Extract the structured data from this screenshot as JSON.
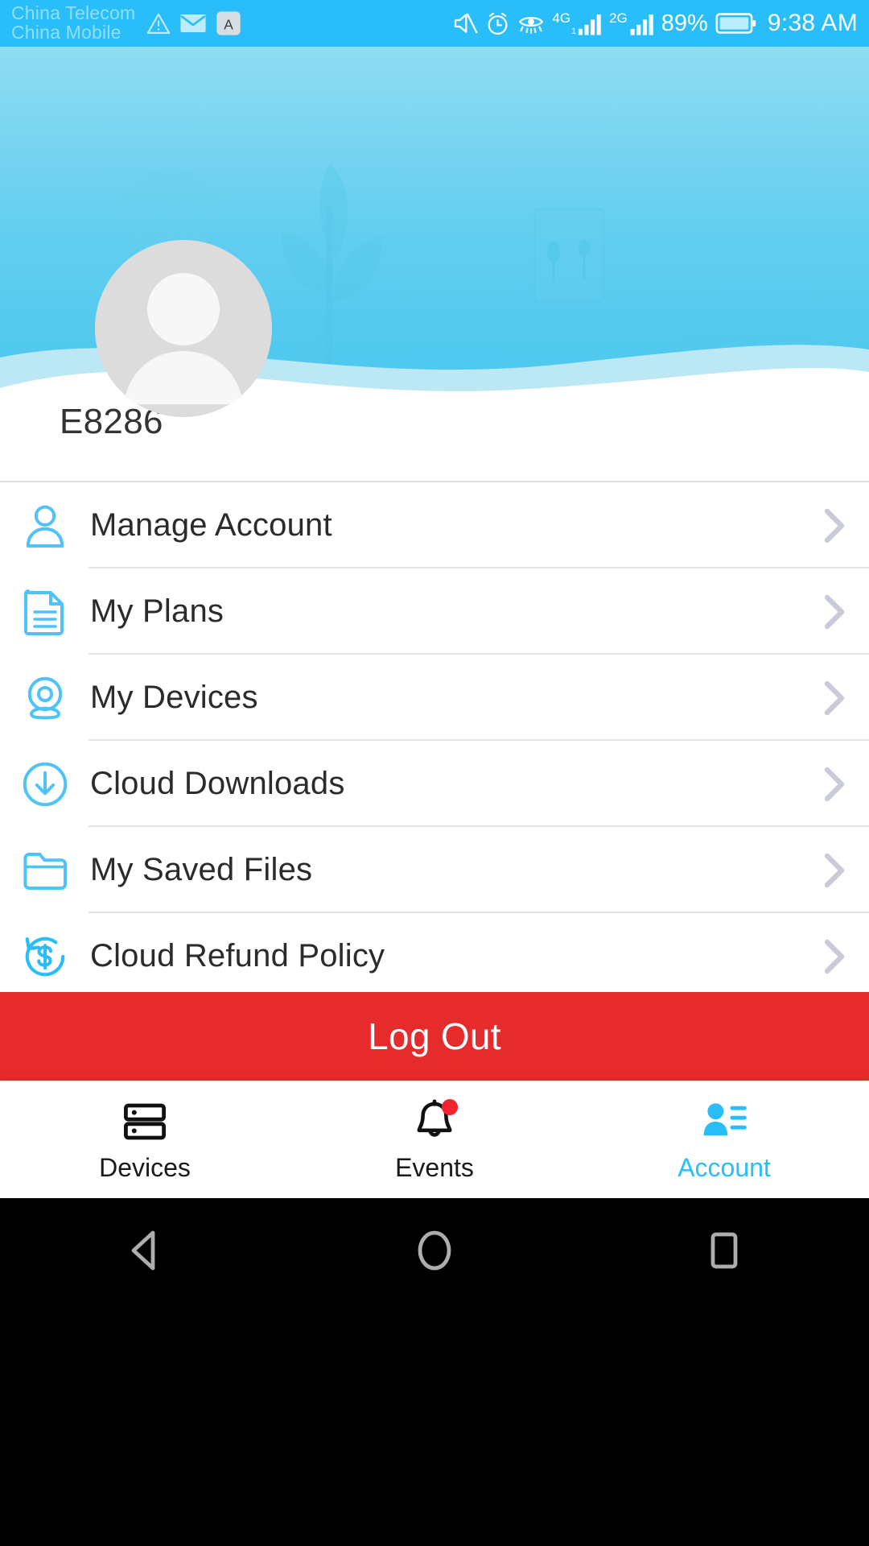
{
  "status_bar": {
    "carriers": [
      "China Telecom",
      "China Mobile"
    ],
    "left_icons": [
      "warning-triangle-icon",
      "mail-icon",
      "input-method-a-icon"
    ],
    "right_icons": [
      "mute-icon",
      "alarm-icon",
      "eye-comfort-icon",
      "signal-4g-icon",
      "signal-2g-icon",
      "battery-icon"
    ],
    "network_4g_label": "4G",
    "network_2g_label": "2G",
    "battery_percent": "89%",
    "time": "9:38 AM"
  },
  "profile": {
    "username": "E8286",
    "avatar_icon": "default-user-avatar"
  },
  "menu": {
    "items": [
      {
        "label": "Manage Account",
        "icon": "person-outline-icon",
        "chevron": "chevron-right-icon"
      },
      {
        "label": "My Plans",
        "icon": "document-icon",
        "chevron": "chevron-right-icon"
      },
      {
        "label": "My Devices",
        "icon": "camera-icon",
        "chevron": "chevron-right-icon"
      },
      {
        "label": "Cloud Downloads",
        "icon": "download-circle-icon",
        "chevron": "chevron-right-icon"
      },
      {
        "label": "My Saved Files",
        "icon": "folder-icon",
        "chevron": "chevron-right-icon"
      },
      {
        "label": "Cloud Refund Policy",
        "icon": "refund-dollar-icon",
        "chevron": "chevron-right-icon"
      }
    ]
  },
  "logout": {
    "label": "Log Out"
  },
  "tabbar": {
    "items": [
      {
        "label": "Devices",
        "icon": "devices-stack-icon",
        "active": false,
        "badge": false
      },
      {
        "label": "Events",
        "icon": "bell-icon",
        "active": false,
        "badge": true
      },
      {
        "label": "Account",
        "icon": "account-person-icon",
        "active": true,
        "badge": false
      }
    ]
  },
  "android_nav": {
    "buttons": [
      "back-triangle-icon",
      "home-circle-icon",
      "recents-square-icon"
    ]
  },
  "colors": {
    "accent": "#29BDF9",
    "hero_top": "#8FDCF2",
    "hero_bottom": "#45C6EE",
    "danger": "#E52B2B",
    "text": "#2B2B2B",
    "divider": "#E4E4E4",
    "badge": "#F2222E"
  }
}
